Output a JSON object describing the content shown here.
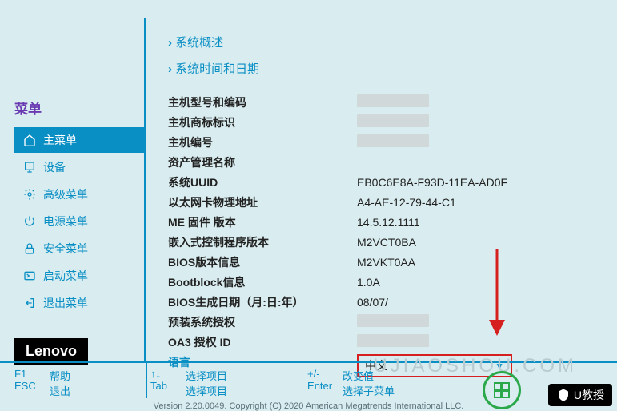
{
  "sidebar": {
    "title": "菜单",
    "items": [
      {
        "label": "主菜单"
      },
      {
        "label": "设备"
      },
      {
        "label": "高级菜单"
      },
      {
        "label": "电源菜单"
      },
      {
        "label": "安全菜单"
      },
      {
        "label": "启动菜单"
      },
      {
        "label": "退出菜单"
      }
    ]
  },
  "logo": "Lenovo",
  "content": {
    "nav": [
      "系统概述",
      "系统时间和日期"
    ],
    "rows": [
      {
        "label": "主机型号和编码",
        "value": "",
        "blurred": true
      },
      {
        "label": "主机商标标识",
        "value": "",
        "blurred": true
      },
      {
        "label": "主机编号",
        "value": "",
        "blurred": true
      },
      {
        "label": "资产管理名称",
        "value": ""
      },
      {
        "label": "系统UUID",
        "value": "EB0C6E8A-F93D-11EA-AD0F"
      },
      {
        "label": "以太网卡物理地址",
        "value": "A4-AE-12-79-44-C1"
      },
      {
        "label": "ME 固件 版本",
        "value": "14.5.12.1111"
      },
      {
        "label": "嵌入式控制程序版本",
        "value": "M2VCT0BA"
      },
      {
        "label": "BIOS版本信息",
        "value": "M2VKT0AA"
      },
      {
        "label": "Bootblock信息",
        "value": "1.0A"
      },
      {
        "label": "BIOS生成日期（月:日:年）",
        "value": "08/07/"
      },
      {
        "label": "预装系统授权",
        "value": "",
        "blurred": true
      },
      {
        "label": "OA3 授权 ID",
        "value": "",
        "blurred": true
      }
    ],
    "language": {
      "label": "语言",
      "value": "中文"
    }
  },
  "footer": {
    "f1_key": "F1",
    "f1_label": "帮助",
    "esc_key": "ESC",
    "esc_label": "退出",
    "arrows_key": "↑↓",
    "arrows_label": "选择项目",
    "tab_key": "Tab",
    "tab_label": "选择项目",
    "pm_key": "+/-",
    "pm_label": "改变值",
    "enter_key": "Enter",
    "enter_label": "选择子菜单",
    "copyright": "Version 2.20.0049. Copyright (C) 2020 American Megatrends International LLC."
  },
  "watermark": {
    "brand": "U教授",
    "url_hint": "UJIAOSHOU.COM"
  }
}
